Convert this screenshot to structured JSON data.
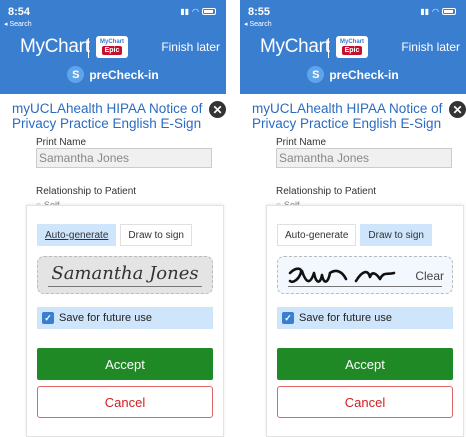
{
  "screens": [
    {
      "time": "8:54",
      "back": "◂ Search",
      "brand": "MyChart",
      "epic_top": "MyChart",
      "epic_bottom": "Epic",
      "finish_label": "Finish later",
      "step_badge": "S",
      "step_label": "preCheck-in",
      "doc_title": "myUCLAhealth HIPAA Notice of Privacy Practice English E-Sign",
      "print_name_label": "Print Name",
      "print_name_value": "Samantha Jones",
      "relationship_label": "Relationship to Patient",
      "relationship_peek": "○ Self",
      "tabs": [
        "Auto-generate",
        "Draw to sign"
      ],
      "active_tab": "Auto-generate",
      "signature_text": "Samantha Jones",
      "save_label": "Save for future use",
      "save_checked": true,
      "accept_label": "Accept",
      "cancel_label": "Cancel"
    },
    {
      "time": "8:55",
      "back": "◂ Search",
      "brand": "MyChart",
      "epic_top": "MyChart",
      "epic_bottom": "Epic",
      "finish_label": "Finish later",
      "step_badge": "S",
      "step_label": "preCheck-in",
      "doc_title": "myUCLAhealth HIPAA Notice of Privacy Practice English E-Sign",
      "print_name_label": "Print Name",
      "print_name_value": "Samantha Jones",
      "relationship_label": "Relationship to Patient",
      "relationship_peek": "○ Self",
      "tabs": [
        "Auto-generate",
        "Draw to sign"
      ],
      "active_tab": "Draw to sign",
      "clear_label": "Clear",
      "save_label": "Save for future use",
      "save_checked": true,
      "accept_label": "Accept",
      "cancel_label": "Cancel"
    }
  ],
  "colors": {
    "header_blue": "#3a7ed0",
    "title_blue": "#2a6bc2",
    "accept_green": "#1f8a25",
    "cancel_red": "#cc2222",
    "tab_active": "#cfe5fb"
  }
}
